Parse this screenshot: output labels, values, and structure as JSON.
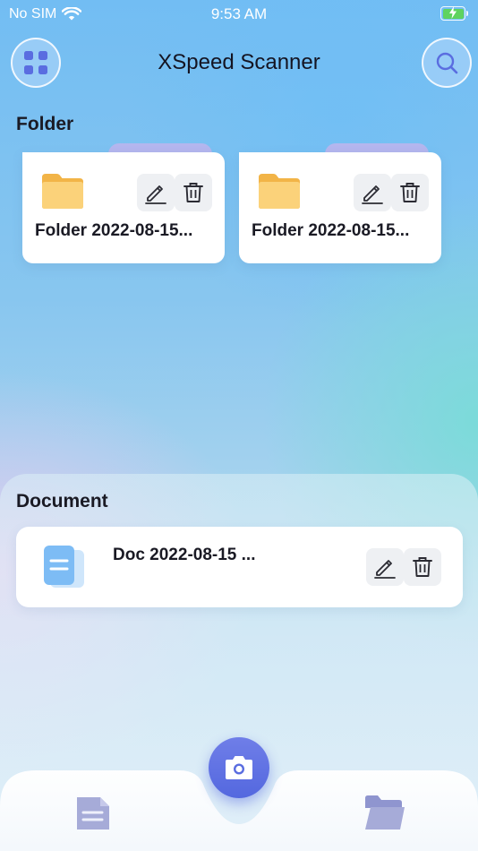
{
  "status_bar": {
    "carrier": "No SIM",
    "time": "9:53 AM",
    "icons": [
      "wifi-icon",
      "battery-charging-icon"
    ]
  },
  "header": {
    "title": "XSpeed Scanner",
    "left_icon": "grid-menu-icon",
    "right_icon": "search-icon"
  },
  "folders": {
    "title": "Folder",
    "items": [
      {
        "name": "Folder 2022-08-15..."
      },
      {
        "name": "Folder 2022-08-15..."
      }
    ]
  },
  "documents": {
    "title": "Document",
    "items": [
      {
        "name": "Doc 2022-08-15 ..."
      }
    ]
  },
  "bottom_nav": {
    "items": [
      "documents-tab-icon",
      "camera-icon",
      "folder-tab-icon"
    ]
  },
  "colors": {
    "accent": "#5a6de0",
    "folder_tab": "#b4b6ee",
    "folder_yellow": "#f7c460",
    "doc_blue": "#7dbcf5"
  }
}
